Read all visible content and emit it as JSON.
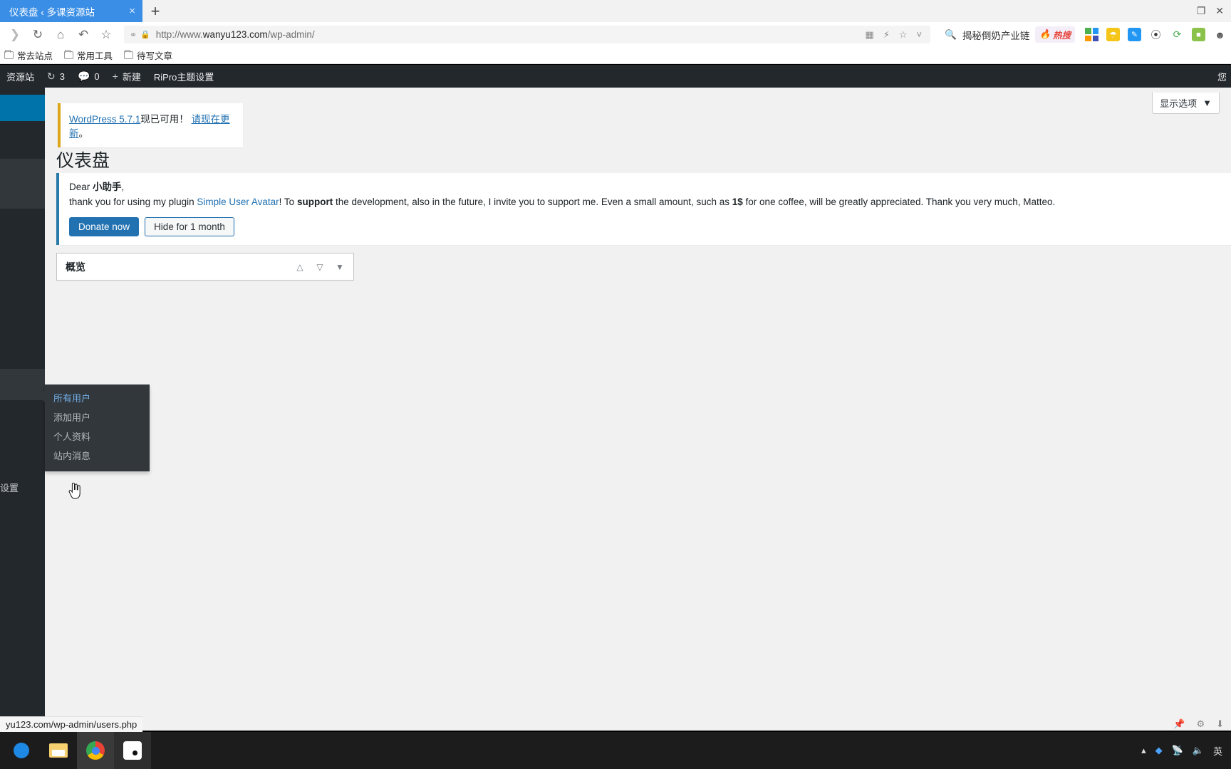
{
  "browser": {
    "tab": {
      "title": "仪表盘 ‹ 多课资源站",
      "close_icon": "close-icon"
    },
    "new_tab_label": "+",
    "window_controls": [
      "restore-icon",
      "minimize-icon"
    ],
    "nav": {
      "forward": "›",
      "reload": "⟳",
      "home": "⌂",
      "back_arrow": "↰",
      "star": "☆"
    },
    "url": {
      "protocol": "http://www.",
      "host": "wanyu123.com",
      "path": "/wp-admin/"
    },
    "url_right_icons": [
      "qr-code-icon",
      "lightning-icon",
      "star-icon",
      "chevron-down-icon"
    ],
    "search": {
      "icon": "search-icon",
      "query": "揭秘倒奶产业链",
      "badge": "热搜"
    },
    "extension_icons": [
      "windows-tiles-icon",
      "yellow-shield-icon",
      "blue-pen-icon",
      "gesture-icon",
      "green-check-icon",
      "puzzle-icon"
    ],
    "bookmarks": [
      {
        "label": "常去站点"
      },
      {
        "label": "常用工具"
      },
      {
        "label": "待写文章"
      }
    ]
  },
  "wp_admin_bar": {
    "site_name": "资源站",
    "updates": {
      "icon": "update-icon",
      "count": "3"
    },
    "comments": {
      "icon": "comment-icon",
      "count": "0"
    },
    "new": {
      "icon": "plus-icon",
      "label": "新建"
    },
    "theme_settings": "RiPro主题设置",
    "howdy": "您"
  },
  "sidebar": {
    "labels": [
      {
        "text": "设置",
        "top": "560"
      }
    ]
  },
  "screen_options": {
    "label": "显示选项",
    "caret": "▼"
  },
  "update_notice": {
    "link_version": "WordPress 5.7.1",
    "text_mid": "现已可用！",
    "link_update": "请现在更新",
    "text_end": "。"
  },
  "page": {
    "title": "仪表盘"
  },
  "donate_notice": {
    "greeting_prefix": "Dear ",
    "greeting_name": "小助手",
    "greeting_suffix": ",",
    "body_a": "thank you for using my plugin ",
    "body_link": "Simple User Avatar",
    "body_b": "! To ",
    "body_bold1": "support",
    "body_c": " the development, also in the future, I invite you to support me. Even a small amount, such as ",
    "body_bold2": "1$",
    "body_d": " for one coffee, will be greatly appreciated. Thank you very much, Matteo.",
    "donate_label": "Donate now",
    "hide_label": "Hide for 1 month"
  },
  "widget": {
    "title": "概览",
    "controls": [
      "chevron-up-icon",
      "chevron-down-icon",
      "caret-down-icon"
    ]
  },
  "flyout_menu": {
    "items": [
      {
        "label": "所有用户",
        "current": true
      },
      {
        "label": "添加用户",
        "current": false
      },
      {
        "label": "个人资料",
        "current": false
      },
      {
        "label": "站内消息",
        "current": false
      }
    ]
  },
  "status_bar": {
    "url": "yu123.com/wp-admin/users.php"
  },
  "admin_footer_icons": [
    "pin-icon",
    "sync-icon",
    "download-icon"
  ],
  "taskbar": {
    "items": [
      "start-icon",
      "file-explorer-icon",
      "chrome-icon",
      "app-window-icon"
    ],
    "tray": [
      "chevron-up-icon",
      "tray-blue-icon",
      "network-icon",
      "volume-icon",
      "ime-label"
    ],
    "ime": "英"
  },
  "colors": {
    "tab_active": "#3a8ee6",
    "wp_bar": "#23282d",
    "wp_sidebar": "#23282d",
    "wp_submenu": "#32373c",
    "wp_link": "#2271b1",
    "wp_current": "#72aee6",
    "notice_warning": "#dba617",
    "notice_info": "#2779aa",
    "admin_bg": "#f1f1f1"
  }
}
